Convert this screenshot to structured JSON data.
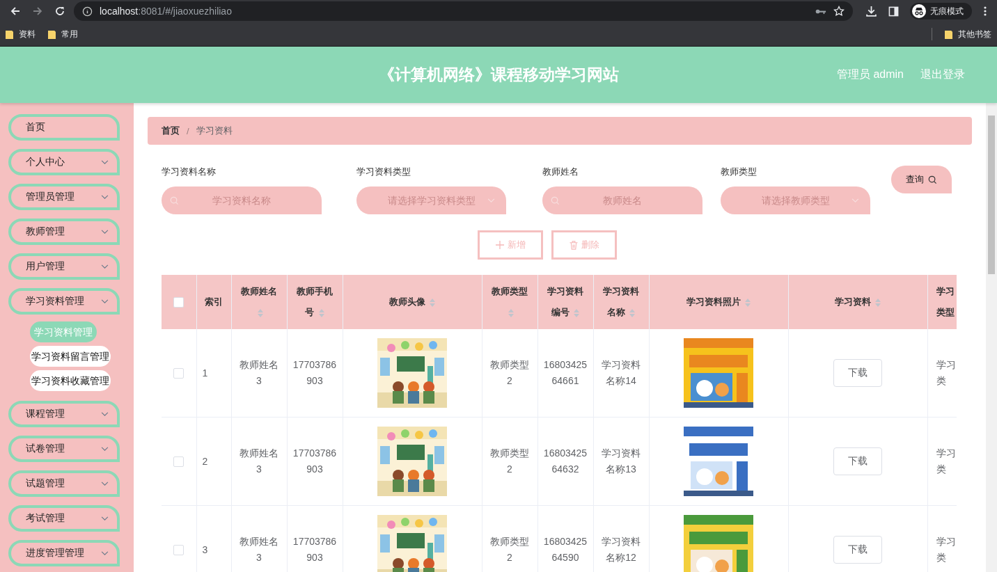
{
  "browser": {
    "url_host": "localhost",
    "url_rest": ":8081/#/jiaoxuezhiliao",
    "profile_label": "无痕模式",
    "bookmarks": [
      "资料",
      "常用"
    ],
    "other_bookmarks": "其他书签"
  },
  "header": {
    "title": "《计算机网络》课程移动学习网站",
    "user": "管理员 admin",
    "logout": "退出登录"
  },
  "sidebar": {
    "items": [
      {
        "label": "首页",
        "kind": "link"
      },
      {
        "label": "个人中心",
        "kind": "menu"
      },
      {
        "label": "管理员管理",
        "kind": "menu"
      },
      {
        "label": "教师管理",
        "kind": "menu"
      },
      {
        "label": "用户管理",
        "kind": "menu"
      },
      {
        "label": "学习资料管理",
        "kind": "menu",
        "children": [
          {
            "label": "学习资料管理",
            "selected": true
          },
          {
            "label": "学习资料留言管理",
            "selected": false
          },
          {
            "label": "学习资料收藏管理",
            "selected": false
          }
        ]
      },
      {
        "label": "课程管理",
        "kind": "menu"
      },
      {
        "label": "试卷管理",
        "kind": "menu"
      },
      {
        "label": "试题管理",
        "kind": "menu"
      },
      {
        "label": "考试管理",
        "kind": "menu"
      },
      {
        "label": "进度管理管理",
        "kind": "menu"
      }
    ]
  },
  "breadcrumb": {
    "items": [
      "首页",
      "学习资料"
    ],
    "separator": "/"
  },
  "search": {
    "fields": [
      {
        "label": "学习资料名称",
        "placeholder": "学习资料名称",
        "kind": "text"
      },
      {
        "label": "学习资料类型",
        "placeholder": "请选择学习资料类型",
        "kind": "select"
      },
      {
        "label": "教师姓名",
        "placeholder": "教师姓名",
        "kind": "text"
      },
      {
        "label": "教师类型",
        "placeholder": "请选择教师类型",
        "kind": "select"
      }
    ],
    "query_button": "查询"
  },
  "actions": [
    {
      "label": "新增",
      "kind": "add"
    },
    {
      "label": "删除",
      "kind": "delete"
    }
  ],
  "table": {
    "select_all": {
      "checked": false
    },
    "columns": [
      {
        "label": "索引",
        "sortable": false
      },
      {
        "label": "教师姓名",
        "sortable": true
      },
      {
        "label": "教师手机号",
        "sortable": true
      },
      {
        "label": "教师头像",
        "sortable": true
      },
      {
        "label": "教师类型",
        "sortable": true
      },
      {
        "label": "学习资料编号",
        "sortable": true
      },
      {
        "label": "学习资料名称",
        "sortable": true
      },
      {
        "label": "学习资料照片",
        "sortable": true
      },
      {
        "label": "学习资料",
        "sortable": true
      },
      {
        "label_lines": [
          "学习",
          "类型"
        ],
        "sortable": false
      }
    ],
    "rows": [
      {
        "checked": false,
        "index": "1",
        "teacher_name": "教师姓名3",
        "phone": "17703786903",
        "avatar": {
          "kind": "picture"
        },
        "teacher_type": "教师类型2",
        "code": "1680342564661",
        "name": "学习资料名称14",
        "photo": {
          "kind": "picture"
        },
        "file_button": "下载",
        "column_11_lines": [
          "学习",
          "类"
        ]
      },
      {
        "checked": false,
        "index": "2",
        "teacher_name": "教师姓名3",
        "phone": "17703786903",
        "avatar": {
          "kind": "picture"
        },
        "teacher_type": "教师类型2",
        "code": "1680342564632",
        "name": "学习资料名称13",
        "photo": {
          "kind": "picture"
        },
        "file_button": "下载",
        "column_11_lines": [
          "学习",
          "类"
        ]
      },
      {
        "checked": false,
        "index": "3",
        "teacher_name": "教师姓名3",
        "phone": "17703786903",
        "avatar": {
          "kind": "picture"
        },
        "teacher_type": "教师类型2",
        "code": "1680342564590",
        "name": "学习资料名称12",
        "photo": {
          "kind": "picture"
        },
        "file_button": "下载",
        "column_11_lines": [
          "学习",
          "类"
        ]
      }
    ]
  }
}
